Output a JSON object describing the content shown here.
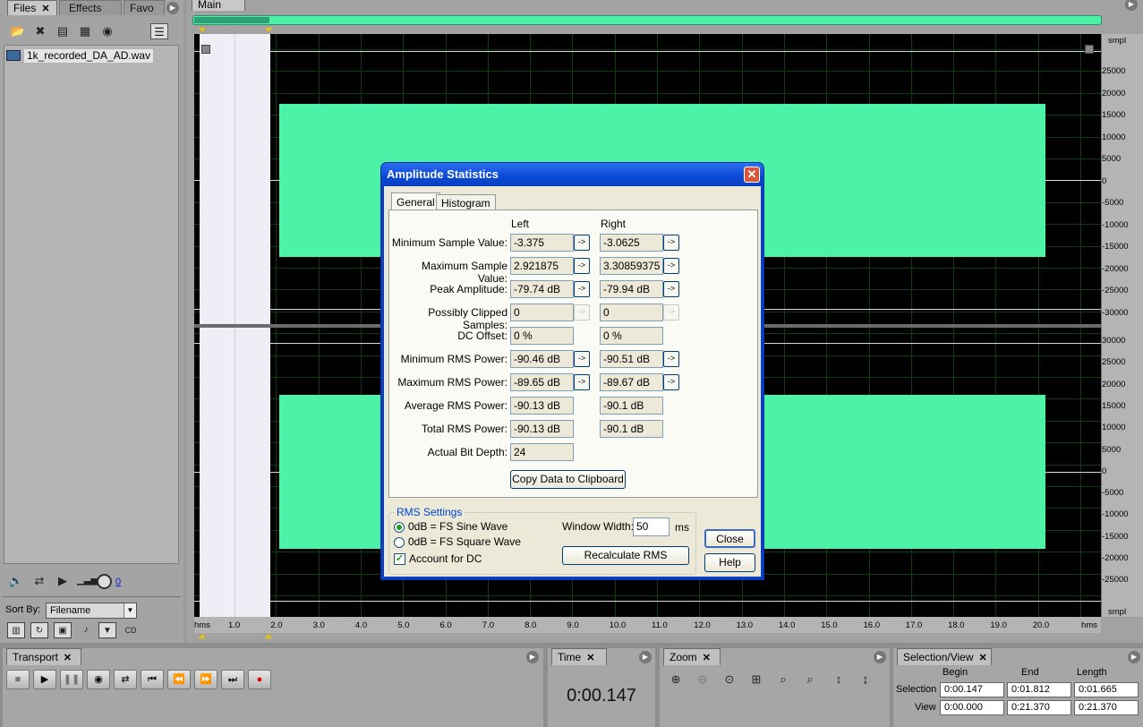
{
  "files_panel": {
    "tabs": [
      {
        "label": "Files"
      },
      {
        "label": "Effects"
      },
      {
        "label": "Favo"
      }
    ],
    "file_item": "1k_recorded_DA_AD.wav",
    "volume_value": "0",
    "sort_by_label": "Sort By:",
    "sort_by_value": "Filename"
  },
  "main_panel": {
    "tab_label": "Main",
    "y_unit_top": "smpl",
    "y_unit_bottom": "smpl",
    "x_unit_left": "hms",
    "x_unit_right": "hms",
    "y_ticks_top": [
      "25000",
      "20000",
      "15000",
      "10000",
      "5000",
      "0",
      "-5000",
      "-10000",
      "-15000",
      "-20000",
      "-25000",
      "-30000"
    ],
    "y_ticks_bottom": [
      "30000",
      "25000",
      "20000",
      "15000",
      "10000",
      "5000",
      "0",
      "-5000",
      "-10000",
      "-15000",
      "-20000",
      "-25000"
    ],
    "x_ticks": [
      "1.0",
      "2.0",
      "3.0",
      "4.0",
      "5.0",
      "6.0",
      "7.0",
      "8.0",
      "9.0",
      "10.0",
      "11.0",
      "12.0",
      "13.0",
      "14.0",
      "15.0",
      "16.0",
      "17.0",
      "18.0",
      "19.0",
      "20.0"
    ],
    "colors": {
      "waveform": "#4cf2a6",
      "background": "#000000",
      "selection": "#eeeef6"
    }
  },
  "dialog": {
    "title": "Amplitude Statistics",
    "tabs": [
      "General",
      "Histogram"
    ],
    "col_left": "Left",
    "col_right": "Right",
    "rows": [
      {
        "label": "Minimum Sample Value:",
        "left": "-3.375",
        "right": "-3.0625"
      },
      {
        "label": "Maximum Sample Value:",
        "left": "2.921875",
        "right": "3.30859375"
      },
      {
        "label": "Peak Amplitude:",
        "left": "-79.74 dB",
        "right": "-79.94 dB"
      },
      {
        "label": "Possibly Clipped Samples:",
        "left": "0",
        "right": "0"
      },
      {
        "label": "DC Offset:",
        "left": "0 %",
        "right": "0 %"
      },
      {
        "label": "Minimum RMS Power:",
        "left": "-90.46 dB",
        "right": "-90.51 dB"
      },
      {
        "label": "Maximum RMS Power:",
        "left": "-89.65 dB",
        "right": "-89.67 dB"
      },
      {
        "label": "Average RMS Power:",
        "left": "-90.13 dB",
        "right": "-90.1 dB"
      },
      {
        "label": "Total RMS Power:",
        "left": "-90.13 dB",
        "right": "-90.1 dB"
      },
      {
        "label": "Actual Bit Depth:",
        "left": "24"
      }
    ],
    "arrow_label": "->",
    "copy_button": "Copy Data to Clipboard",
    "rms_settings_title": "RMS Settings",
    "radio_sine": "0dB = FS Sine Wave",
    "radio_square": "0dB = FS Square Wave",
    "checkbox_dc": "Account for DC",
    "window_width_label": "Window Width:",
    "window_width_value": "50",
    "window_width_unit": "ms",
    "recalc_button": "Recalculate RMS",
    "close_button": "Close",
    "help_button": "Help"
  },
  "transport": {
    "tab_label": "Transport"
  },
  "time": {
    "tab_label": "Time",
    "value": "0:00.147"
  },
  "zoom": {
    "tab_label": "Zoom"
  },
  "selection_view": {
    "tab_label": "Selection/View",
    "col_begin": "Begin",
    "col_end": "End",
    "col_length": "Length",
    "row_selection": "Selection",
    "row_view": "View",
    "selection_begin": "0:00.147",
    "selection_end": "0:01.812",
    "selection_length": "0:01.665",
    "view_begin": "0:00.000",
    "view_end": "0:21.370",
    "view_length": "0:21.370"
  }
}
